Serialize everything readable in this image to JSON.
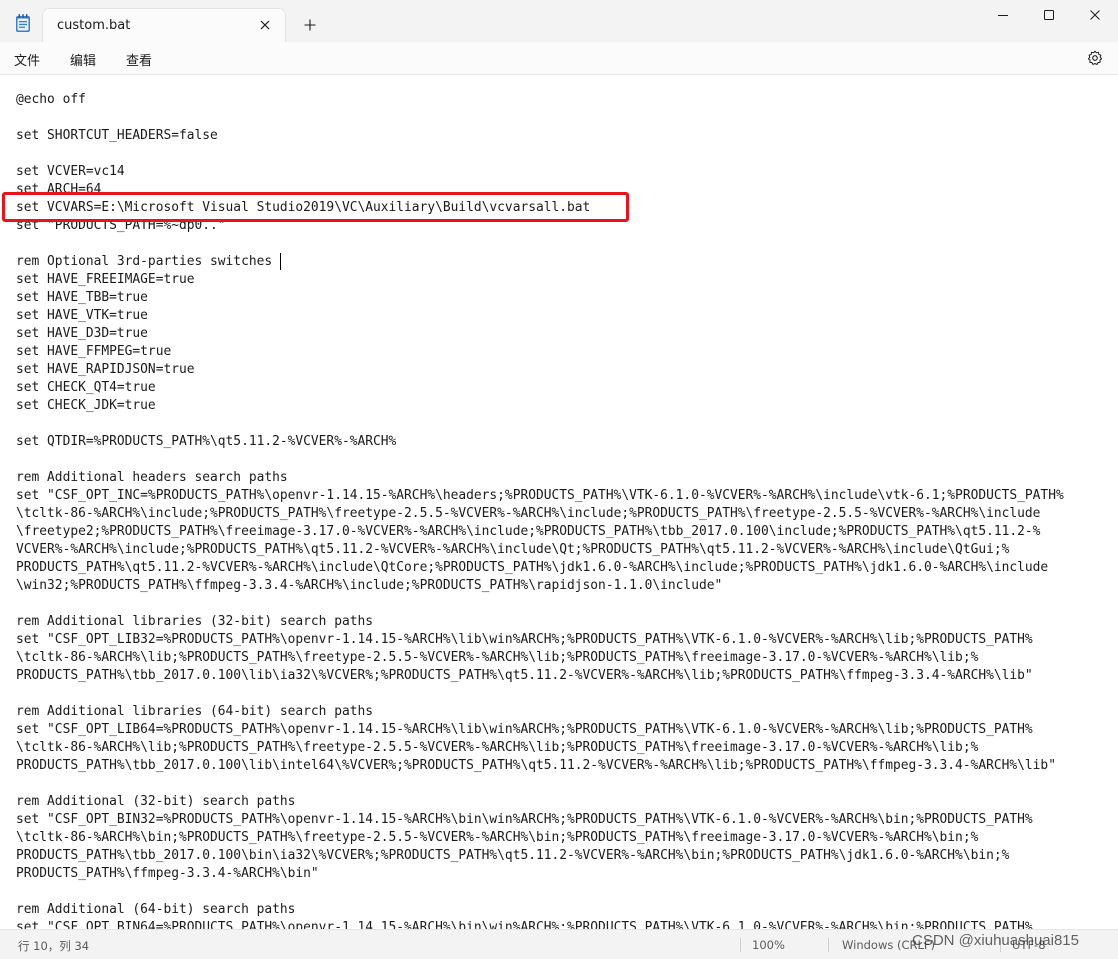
{
  "window": {
    "tab_title": "custom.bat",
    "icons": [
      "notepad-icon",
      "close-icon",
      "plus-icon",
      "minimize-icon",
      "maximize-icon",
      "close-icon",
      "gear-icon"
    ]
  },
  "menu": {
    "file": "文件",
    "edit": "编辑",
    "view": "查看"
  },
  "editor": {
    "lines": [
      "@echo off",
      "",
      "set SHORTCUT_HEADERS=false",
      "",
      "set VCVER=vc14",
      "set ARCH=64",
      "set VCVARS=E:\\Microsoft Visual Studio2019\\VC\\Auxiliary\\Build\\vcvarsall.bat",
      "set \"PRODUCTS_PATH=%~dp0..\"",
      "",
      "rem Optional 3rd-parties switches",
      "set HAVE_FREEIMAGE=true",
      "set HAVE_TBB=true",
      "set HAVE_VTK=true",
      "set HAVE_D3D=true",
      "set HAVE_FFMPEG=true",
      "set HAVE_RAPIDJSON=true",
      "set CHECK_QT4=true",
      "set CHECK_JDK=true",
      "",
      "set QTDIR=%PRODUCTS_PATH%\\qt5.11.2-%VCVER%-%ARCH%",
      "",
      "rem Additional headers search paths",
      "set \"CSF_OPT_INC=%PRODUCTS_PATH%\\openvr-1.14.15-%ARCH%\\headers;%PRODUCTS_PATH%\\VTK-6.1.0-%VCVER%-%ARCH%\\include\\vtk-6.1;%PRODUCTS_PATH%",
      "\\tcltk-86-%ARCH%\\include;%PRODUCTS_PATH%\\freetype-2.5.5-%VCVER%-%ARCH%\\include;%PRODUCTS_PATH%\\freetype-2.5.5-%VCVER%-%ARCH%\\include",
      "\\freetype2;%PRODUCTS_PATH%\\freeimage-3.17.0-%VCVER%-%ARCH%\\include;%PRODUCTS_PATH%\\tbb_2017.0.100\\include;%PRODUCTS_PATH%\\qt5.11.2-%",
      "VCVER%-%ARCH%\\include;%PRODUCTS_PATH%\\qt5.11.2-%VCVER%-%ARCH%\\include\\Qt;%PRODUCTS_PATH%\\qt5.11.2-%VCVER%-%ARCH%\\include\\QtGui;%",
      "PRODUCTS_PATH%\\qt5.11.2-%VCVER%-%ARCH%\\include\\QtCore;%PRODUCTS_PATH%\\jdk1.6.0-%ARCH%\\include;%PRODUCTS_PATH%\\jdk1.6.0-%ARCH%\\include",
      "\\win32;%PRODUCTS_PATH%\\ffmpeg-3.3.4-%ARCH%\\include;%PRODUCTS_PATH%\\rapidjson-1.1.0\\include\"",
      "",
      "rem Additional libraries (32-bit) search paths",
      "set \"CSF_OPT_LIB32=%PRODUCTS_PATH%\\openvr-1.14.15-%ARCH%\\lib\\win%ARCH%;%PRODUCTS_PATH%\\VTK-6.1.0-%VCVER%-%ARCH%\\lib;%PRODUCTS_PATH%",
      "\\tcltk-86-%ARCH%\\lib;%PRODUCTS_PATH%\\freetype-2.5.5-%VCVER%-%ARCH%\\lib;%PRODUCTS_PATH%\\freeimage-3.17.0-%VCVER%-%ARCH%\\lib;%",
      "PRODUCTS_PATH%\\tbb_2017.0.100\\lib\\ia32\\%VCVER%;%PRODUCTS_PATH%\\qt5.11.2-%VCVER%-%ARCH%\\lib;%PRODUCTS_PATH%\\ffmpeg-3.3.4-%ARCH%\\lib\"",
      "",
      "rem Additional libraries (64-bit) search paths",
      "set \"CSF_OPT_LIB64=%PRODUCTS_PATH%\\openvr-1.14.15-%ARCH%\\lib\\win%ARCH%;%PRODUCTS_PATH%\\VTK-6.1.0-%VCVER%-%ARCH%\\lib;%PRODUCTS_PATH%",
      "\\tcltk-86-%ARCH%\\lib;%PRODUCTS_PATH%\\freetype-2.5.5-%VCVER%-%ARCH%\\lib;%PRODUCTS_PATH%\\freeimage-3.17.0-%VCVER%-%ARCH%\\lib;%",
      "PRODUCTS_PATH%\\tbb_2017.0.100\\lib\\intel64\\%VCVER%;%PRODUCTS_PATH%\\qt5.11.2-%VCVER%-%ARCH%\\lib;%PRODUCTS_PATH%\\ffmpeg-3.3.4-%ARCH%\\lib\"",
      "",
      "rem Additional (32-bit) search paths",
      "set \"CSF_OPT_BIN32=%PRODUCTS_PATH%\\openvr-1.14.15-%ARCH%\\bin\\win%ARCH%;%PRODUCTS_PATH%\\VTK-6.1.0-%VCVER%-%ARCH%\\bin;%PRODUCTS_PATH%",
      "\\tcltk-86-%ARCH%\\bin;%PRODUCTS_PATH%\\freetype-2.5.5-%VCVER%-%ARCH%\\bin;%PRODUCTS_PATH%\\freeimage-3.17.0-%VCVER%-%ARCH%\\bin;%",
      "PRODUCTS_PATH%\\tbb_2017.0.100\\bin\\ia32\\%VCVER%;%PRODUCTS_PATH%\\qt5.11.2-%VCVER%-%ARCH%\\bin;%PRODUCTS_PATH%\\jdk1.6.0-%ARCH%\\bin;%",
      "PRODUCTS_PATH%\\ffmpeg-3.3.4-%ARCH%\\bin\"",
      "",
      "rem Additional (64-bit) search paths",
      "set \"CSF_OPT_BIN64=%PRODUCTS_PATH%\\openvr-1.14.15-%ARCH%\\bin\\win%ARCH%;%PRODUCTS_PATH%\\VTK-6.1.0-%VCVER%-%ARCH%\\bin;%PRODUCTS_PATH%"
    ],
    "highlight_color": "#e8141b"
  },
  "status": {
    "position": "行 10，列 34",
    "zoom": "100%",
    "eol": "Windows (CRLF)",
    "encoding": "UTF-8"
  },
  "watermark": "CSDN @xiuhuashuai815"
}
